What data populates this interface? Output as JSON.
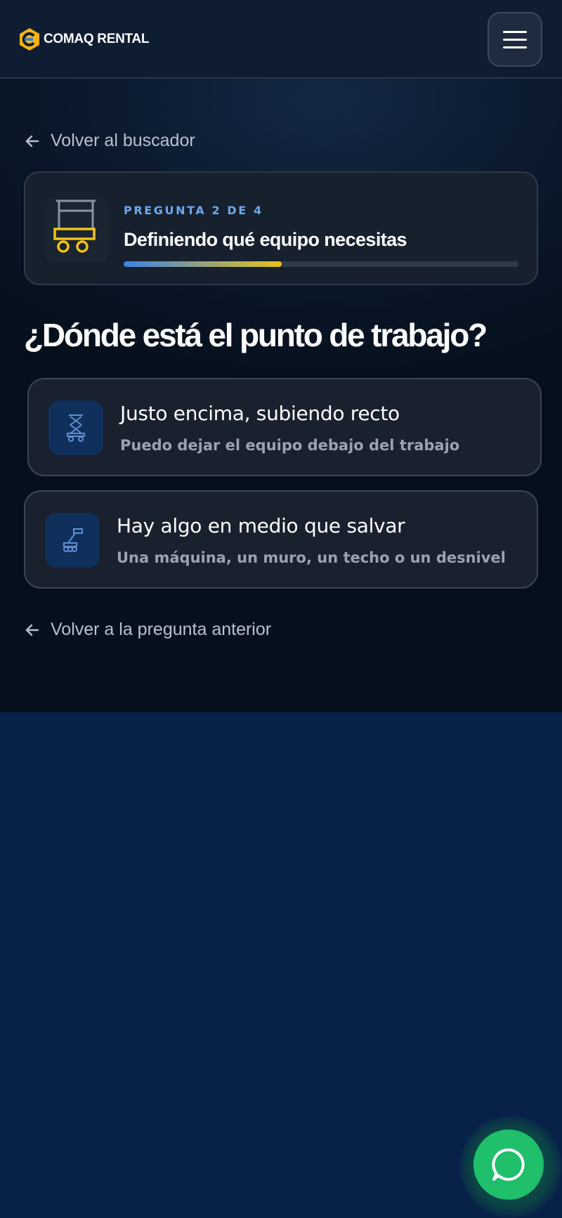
{
  "brand": {
    "name": "COMAQ RENTAL"
  },
  "nav": {
    "back_to_search": "Volver al buscador",
    "back_to_previous": "Volver a la pregunta anterior"
  },
  "progress": {
    "step_label": "PREGUNTA 2 DE 4",
    "title": "Definiendo qué equipo necesitas",
    "fraction": 0.4
  },
  "question": "¿Dónde está el punto de trabajo?",
  "options": [
    {
      "icon": "scissor-lift-icon",
      "title": "Justo encima, subiendo recto",
      "description": "Puedo dejar el equipo debajo del trabajo"
    },
    {
      "icon": "boom-lift-icon",
      "title": "Hay algo en medio que salvar",
      "description": "Una máquina, un muro, un techo o un desnivel"
    }
  ],
  "colors": {
    "accent_blue": "#3b82e6",
    "accent_yellow": "#e9c317",
    "whatsapp_green": "#1fbf6b",
    "page_bg": "#072149"
  }
}
